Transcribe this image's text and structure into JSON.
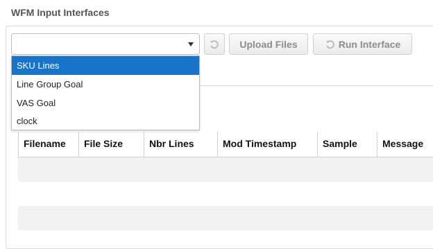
{
  "page": {
    "title": "WFM Input Interfaces"
  },
  "toolbar": {
    "interface_select": {
      "value": ""
    },
    "upload_label": "Upload Files",
    "run_label": "Run Interface"
  },
  "dropdown": {
    "options": [
      "SKU Lines",
      "Line Group Goal",
      "VAS Goal",
      "clock"
    ],
    "highlighted": "SKU Lines"
  },
  "grid": {
    "columns": [
      "Filename",
      "File Size",
      "Nbr Lines",
      "Mod Timestamp",
      "Sample",
      "Message"
    ],
    "rows": []
  },
  "colors": {
    "selection": "#1874c9",
    "row_alt": "#f2f2f2",
    "button_text": "#8c8c8c"
  }
}
